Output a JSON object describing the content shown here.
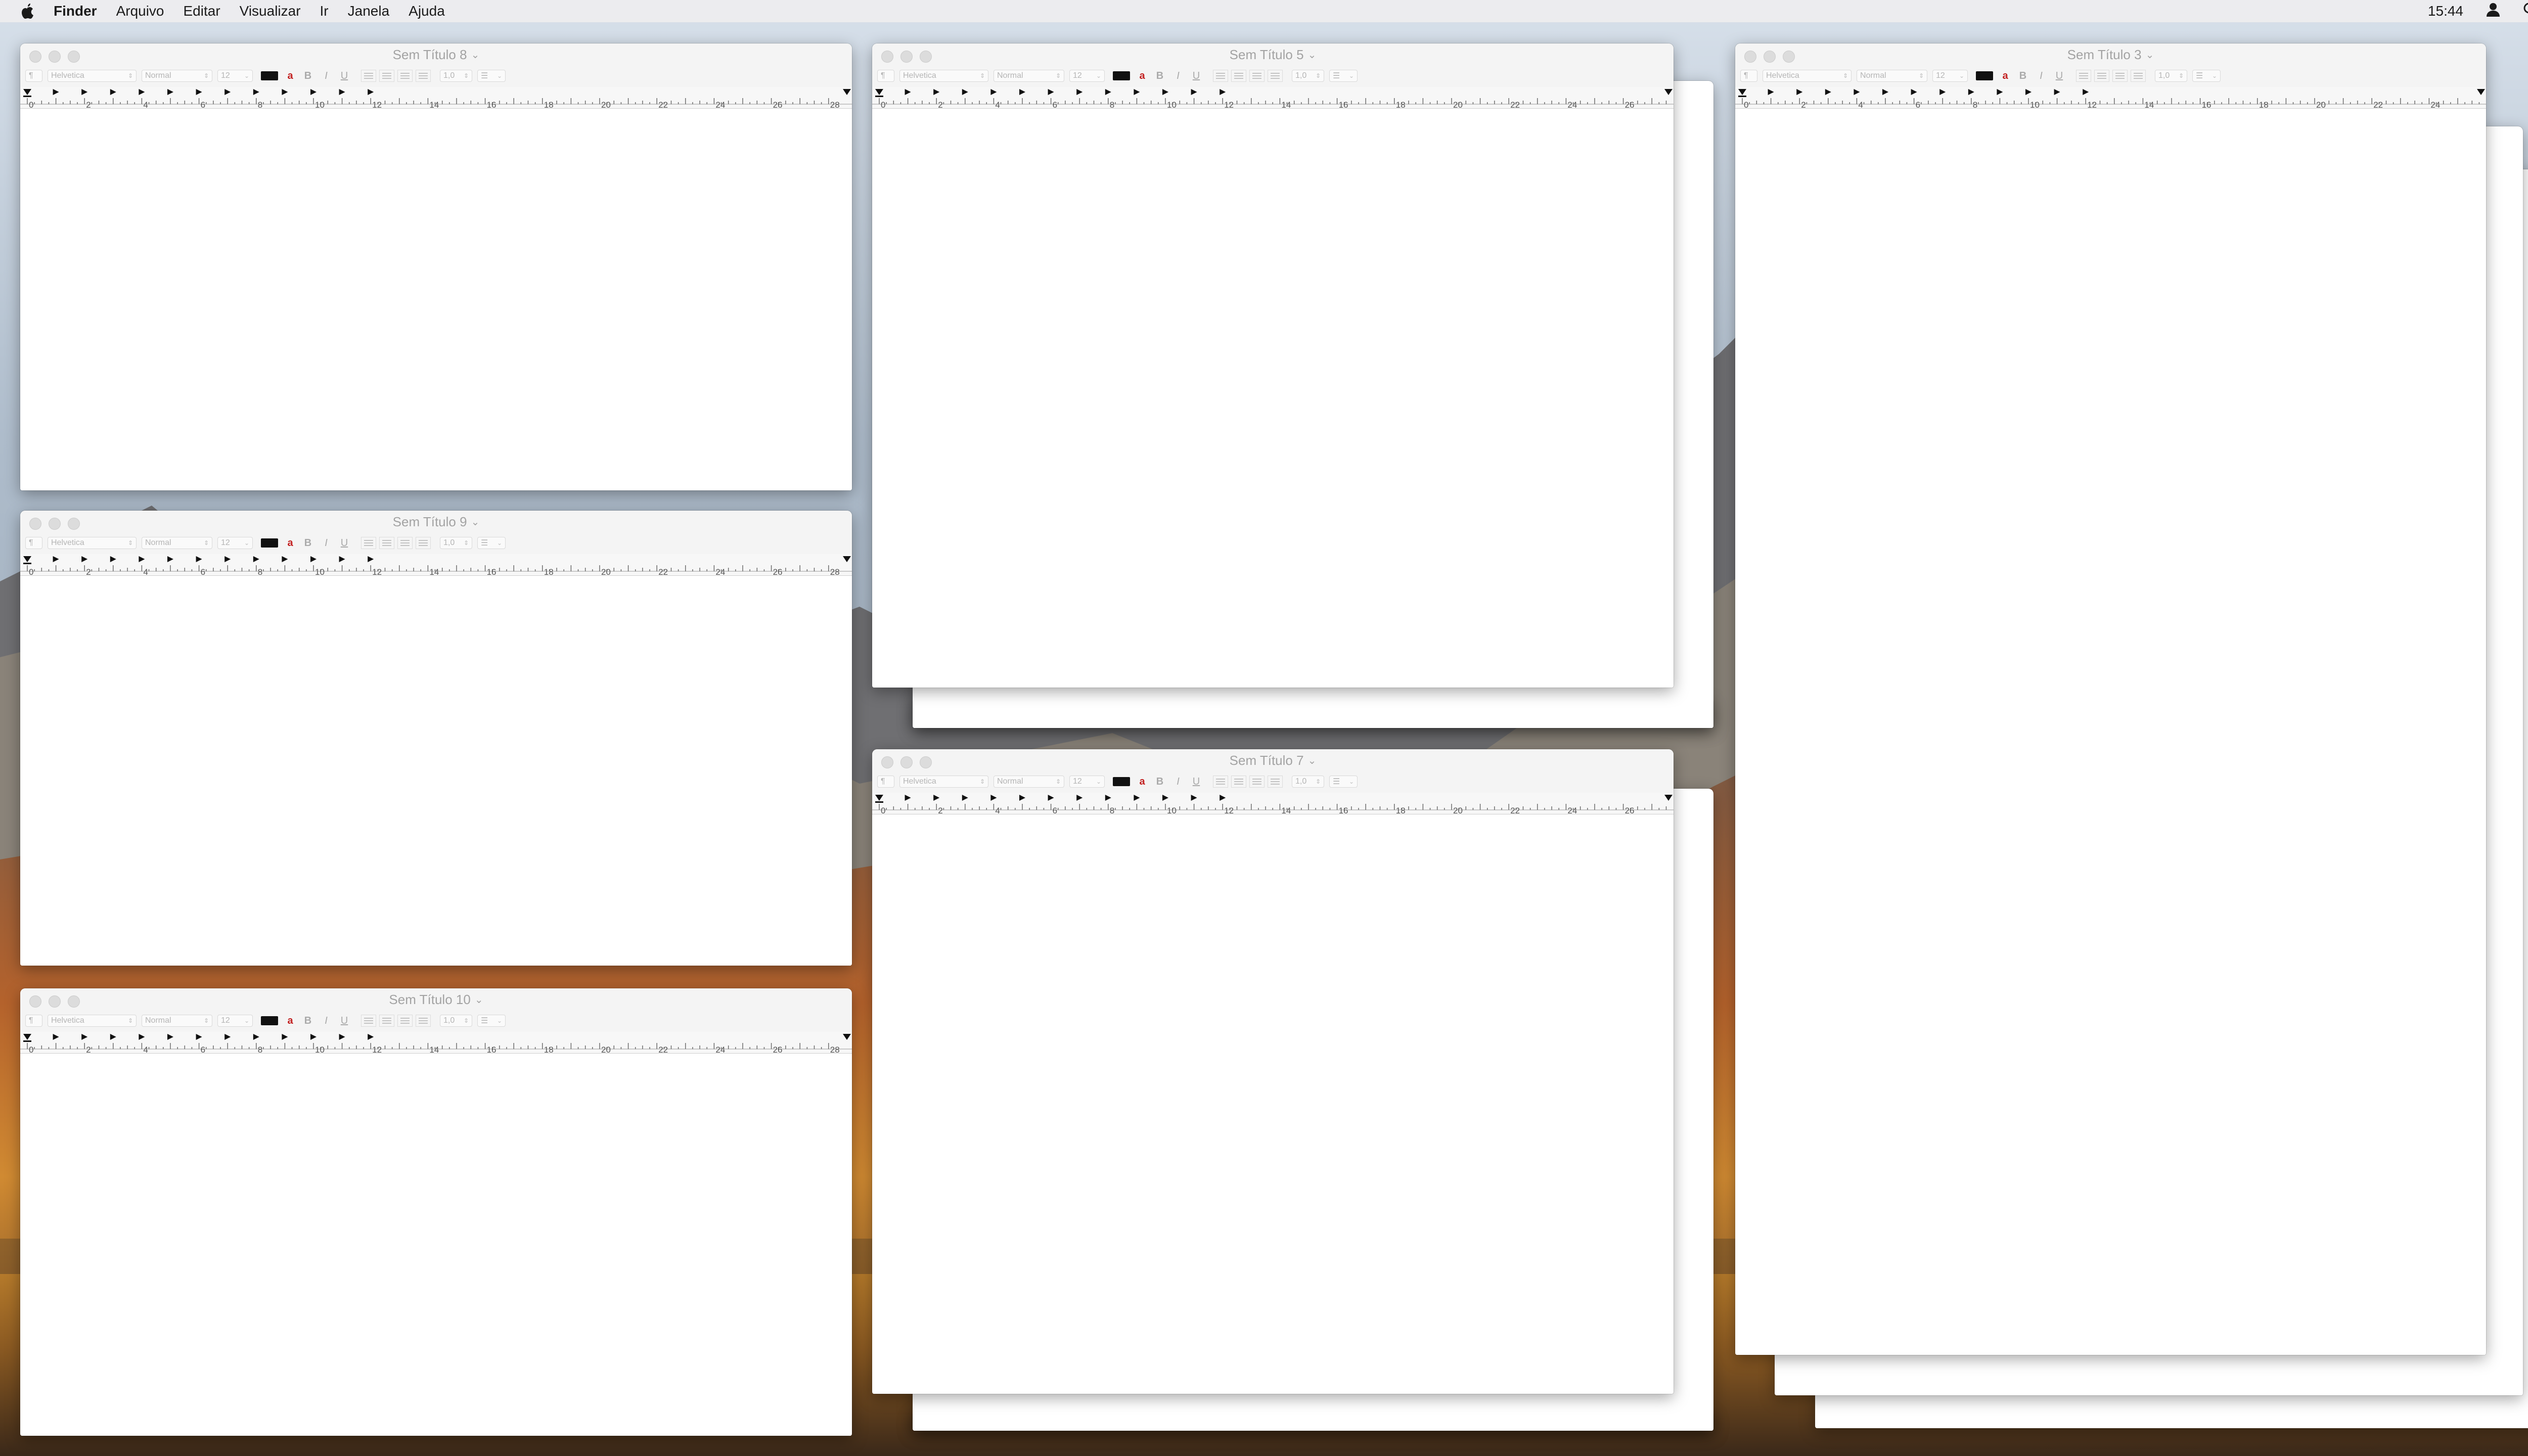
{
  "menubar": {
    "app_name": "Finder",
    "items": [
      "Arquivo",
      "Editar",
      "Visualizar",
      "Ir",
      "Janela",
      "Ajuda"
    ],
    "clock": "15:44",
    "icons": [
      "apple-icon",
      "user-icon",
      "spotlight-search-icon",
      "notification-center-icon"
    ]
  },
  "toolbar": {
    "paragraph_style": "¶",
    "font_family": "Helvetica",
    "font_style": "Normal",
    "font_size": "12",
    "bold": "B",
    "italic": "I",
    "underline": "U",
    "line_spacing": "1,0",
    "text_color": "#000000",
    "highlight_glyph": "a"
  },
  "ruler": {
    "labels": [
      "0",
      "2",
      "4",
      "6",
      "8",
      "10",
      "12",
      "14",
      "16",
      "18",
      "20",
      "22",
      "24",
      "26",
      "28"
    ]
  },
  "windows": [
    {
      "id": "w8",
      "title": "Sem Título 8"
    },
    {
      "id": "w9",
      "title": "Sem Título 9"
    },
    {
      "id": "w10",
      "title": "Sem Título 10"
    },
    {
      "id": "w5",
      "title": "Sem Título 5"
    },
    {
      "id": "w7",
      "title": "Sem Título 7"
    },
    {
      "id": "w3",
      "title": "Sem Título 3"
    }
  ],
  "colors": {
    "menubar_bg": "#ececee",
    "window_title_text": "#a3a3a3",
    "traffic_light_inactive": "#dcdcdc"
  }
}
